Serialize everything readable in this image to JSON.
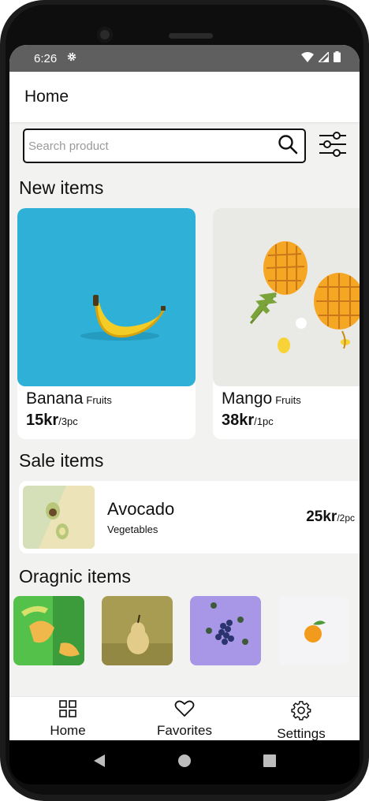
{
  "status_bar": {
    "time": "6:26"
  },
  "app_bar": {
    "title": "Home"
  },
  "search": {
    "placeholder": "Search product",
    "value": ""
  },
  "sections": {
    "new_items": "New items",
    "sale_items": "Sale items",
    "organic_items": "Oragnic items"
  },
  "new_items": [
    {
      "name": "Banana",
      "category": "Fruits",
      "price": "15kr",
      "unit": "/3pc"
    },
    {
      "name": "Mango",
      "category": "Fruits",
      "price": "38kr",
      "unit": "/1pc"
    }
  ],
  "sale_items": [
    {
      "name": "Avocado",
      "category": "Vegetables",
      "price": "25kr",
      "unit": "/2pc"
    }
  ],
  "bottom_nav": {
    "home": "Home",
    "favorites": "Favorites",
    "settings": "Settings"
  },
  "colors": {
    "status_bar": "#5f5f5f",
    "screen_bg": "#f2f2f1",
    "banana_bg": "#2fb0d6",
    "avocado_bg": "#d6e0b8"
  },
  "icons": [
    "settings-gear-icon",
    "wifi-icon",
    "signal-icon",
    "battery-icon",
    "search-icon",
    "filter-icon",
    "grid-icon",
    "heart-icon",
    "gear-icon",
    "back-icon",
    "home-circle-icon",
    "recents-icon"
  ]
}
